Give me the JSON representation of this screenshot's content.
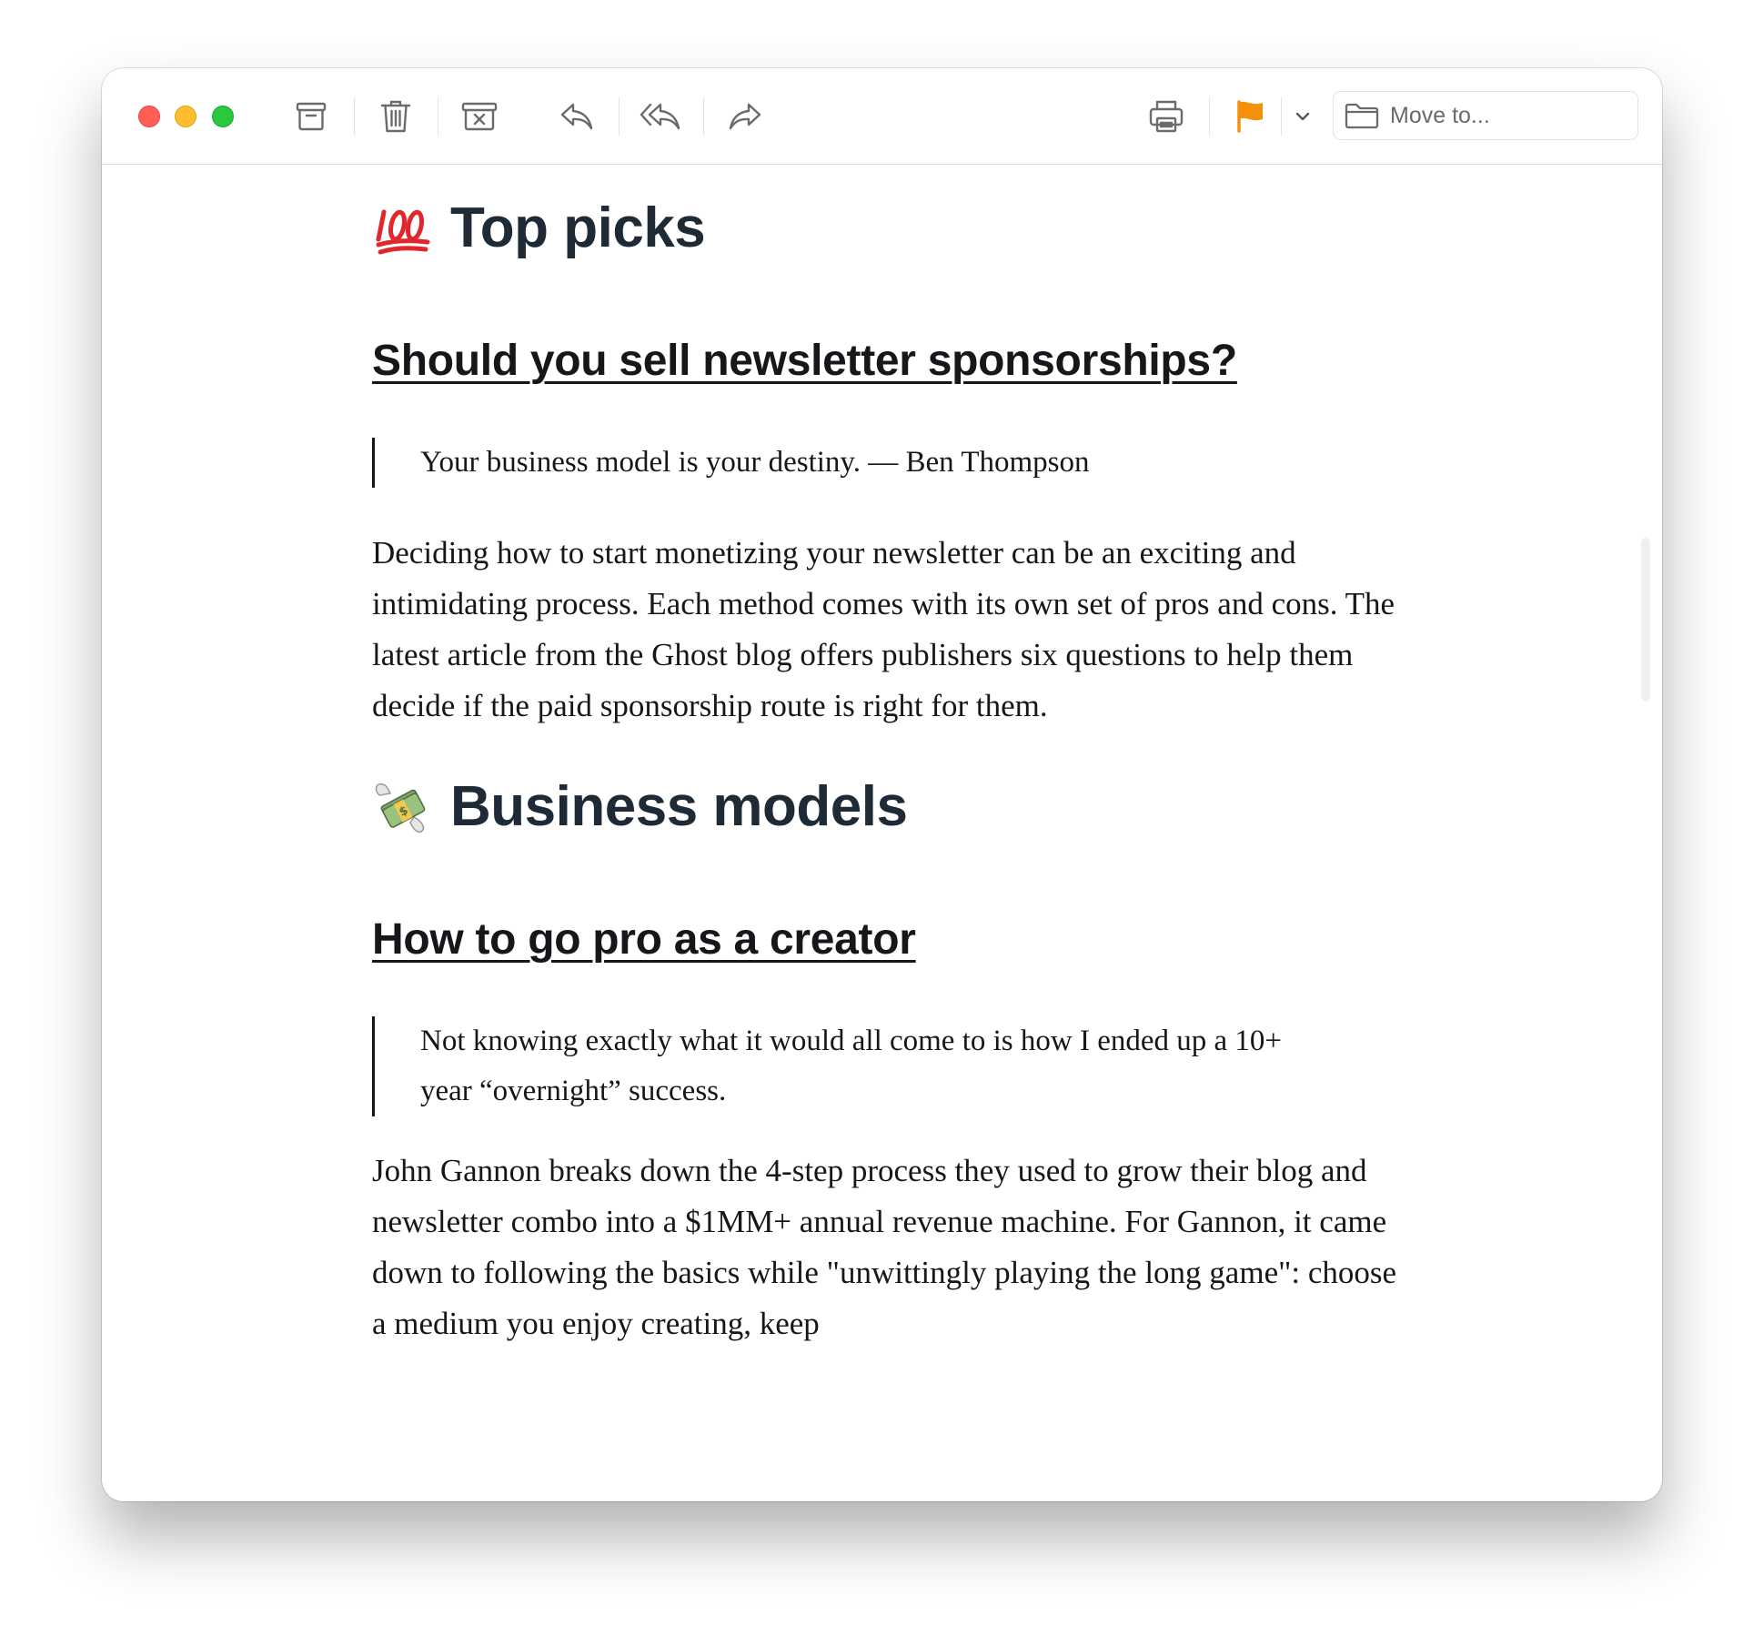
{
  "toolbar": {
    "buttons": [
      {
        "name": "archive",
        "icon": "archive-icon"
      },
      {
        "name": "trash",
        "icon": "trash-icon"
      },
      {
        "name": "junk",
        "icon": "junk-icon"
      },
      {
        "name": "reply",
        "icon": "reply-icon"
      },
      {
        "name": "reply-all",
        "icon": "reply-all-icon"
      },
      {
        "name": "forward",
        "icon": "forward-icon"
      },
      {
        "name": "print",
        "icon": "printer-icon"
      },
      {
        "name": "flag",
        "icon": "flag-icon",
        "color": "#f5900d"
      }
    ],
    "move_to_label": "Move to..."
  },
  "sections": [
    {
      "emoji": "💯",
      "emoji_icon": "hundred-points-icon",
      "title": "Top picks",
      "article": {
        "link_text": "Should you sell newsletter sponsorships?",
        "quote": "Your business model is your destiny. — Ben Thompson",
        "body": "Deciding how to start monetizing your newsletter can be an exciting and intimidating process. Each method comes with its own set of pros and cons. The latest article from the Ghost blog offers publishers six questions to help them decide if the paid sponsorship route is right for them."
      }
    },
    {
      "emoji": "💸",
      "emoji_icon": "money-with-wings-icon",
      "title": "Business models",
      "article": {
        "link_text": "How to go pro as a creator",
        "quote": "Not knowing exactly what it would all come to is how I ended up a 10+ year “overnight” success.",
        "body": "John Gannon breaks down the 4-step process they used to grow their blog and newsletter combo into a $1MM+ annual revenue machine. For Gannon, it came down to following the basics while \"unwittingly playing the long game\": choose a medium you enjoy creating, keep"
      }
    }
  ],
  "colors": {
    "heading": "#1f2a37",
    "text": "#15171a",
    "flag": "#f5900d",
    "close": "#ff5f57",
    "minimize": "#febc2e",
    "zoom": "#28c840"
  }
}
